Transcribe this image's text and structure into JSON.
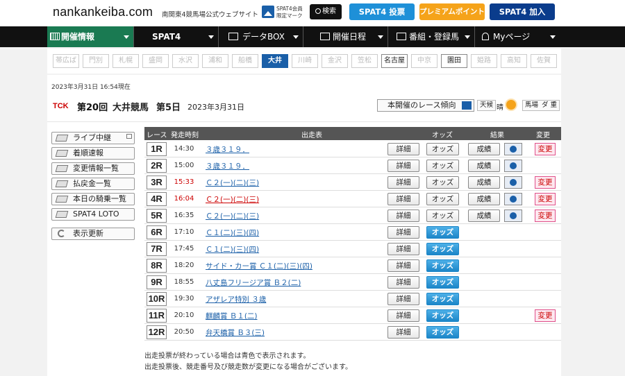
{
  "header": {
    "logo": "nankankeiba.com",
    "site_sub": "南関東4競馬場公式ウェブサイト",
    "member_mark_l1": "SPAT4会員",
    "member_mark_l2": "限定マーク",
    "search_label": "検索",
    "spat4_vote": "SPAT4 投票",
    "premium": "プレミアムポイント",
    "spat4_join": "SPAT4 加入"
  },
  "nav": {
    "items": [
      {
        "label": "開催情報"
      },
      {
        "label": "SPAT4"
      },
      {
        "label": "データBOX"
      },
      {
        "label": "開催日程"
      },
      {
        "label": "番組・登録馬"
      },
      {
        "label": "Myページ"
      }
    ]
  },
  "tracks": [
    "帯広ば",
    "門別",
    "札幌",
    "盛岡",
    "水沢",
    "浦和",
    "船橋",
    "大井",
    "川崎",
    "金沢",
    "笠松",
    "名古屋",
    "中京",
    "園田",
    "姫路",
    "高知",
    "佐賀"
  ],
  "meeting": {
    "timestamp": "2023年3月31日 16:54現在",
    "logo": "TCK",
    "title_no": "第20回",
    "title_track": "大井競馬",
    "title_day": "第5日",
    "date": "2023年3月31日",
    "trend_button": "本開催のレース傾向",
    "weather_label": "天候",
    "weather_value": "晴",
    "track_label": "馬場",
    "track_value": "ダ 重"
  },
  "side_menu": {
    "live": "ライブ中継",
    "arrival": "着順速報",
    "changes": "変更情報一覧",
    "payout": "払戻金一覧",
    "riders": "本日の騎乗一覧",
    "loto": "SPAT4 LOTO",
    "refresh": "表示更新"
  },
  "table": {
    "headers": {
      "race": "レース",
      "time": "発走時刻",
      "entries": "出走表",
      "odds": "オッズ",
      "result": "結果",
      "change": "変更"
    },
    "detail_label": "詳細",
    "odds_label": "オッズ",
    "result_label": "成績",
    "change_label": "変更",
    "rows": [
      {
        "no": "1R",
        "time": "14:30",
        "name": "３歳３１９．",
        "red": false,
        "result": true,
        "change": true,
        "blue": false
      },
      {
        "no": "2R",
        "time": "15:00",
        "name": "３歳３１９．",
        "red": false,
        "result": true,
        "change": false,
        "blue": false
      },
      {
        "no": "3R",
        "time": "15:33",
        "name": "Ｃ２(一)(二)(三)",
        "red": false,
        "time_red": true,
        "result": true,
        "change": true,
        "blue": false
      },
      {
        "no": "4R",
        "time": "16:04",
        "name": "Ｃ２(一)(二)(三)",
        "red": true,
        "time_red": true,
        "result": true,
        "change": true,
        "blue": false
      },
      {
        "no": "5R",
        "time": "16:35",
        "name": "Ｃ２(一)(二)(三)",
        "red": false,
        "result": true,
        "change": true,
        "blue": false
      },
      {
        "no": "6R",
        "time": "17:10",
        "name": "Ｃ１(二)(三)(四)",
        "red": false,
        "result": false,
        "change": false,
        "blue": true
      },
      {
        "no": "7R",
        "time": "17:45",
        "name": "Ｃ１(二)(三)(四)",
        "red": false,
        "result": false,
        "change": false,
        "blue": true
      },
      {
        "no": "8R",
        "time": "18:20",
        "name": "サイド・カー賞 Ｃ１(二)(三)(四)",
        "red": false,
        "result": false,
        "change": false,
        "blue": true
      },
      {
        "no": "9R",
        "time": "18:55",
        "name": "八丈島フリージア賞 Ｂ２(二)",
        "red": false,
        "result": false,
        "change": false,
        "blue": true
      },
      {
        "no": "10R",
        "time": "19:30",
        "name": "アザレア特別 ３歳",
        "red": false,
        "result": false,
        "change": false,
        "blue": true
      },
      {
        "no": "11R",
        "time": "20:10",
        "name": "麒麟賞 Ｂ１(二)",
        "red": false,
        "result": false,
        "change": true,
        "blue": true
      },
      {
        "no": "12R",
        "time": "20:50",
        "name": "弁天橋賞 Ｂ３(三)",
        "red": false,
        "result": false,
        "change": false,
        "blue": true
      }
    ]
  },
  "notes": {
    "n1": "出走投票が終わっている場合は青色で表示されます。",
    "n2": "出走投票後、競走番号及び競走数が変更になる場合がございます。"
  }
}
